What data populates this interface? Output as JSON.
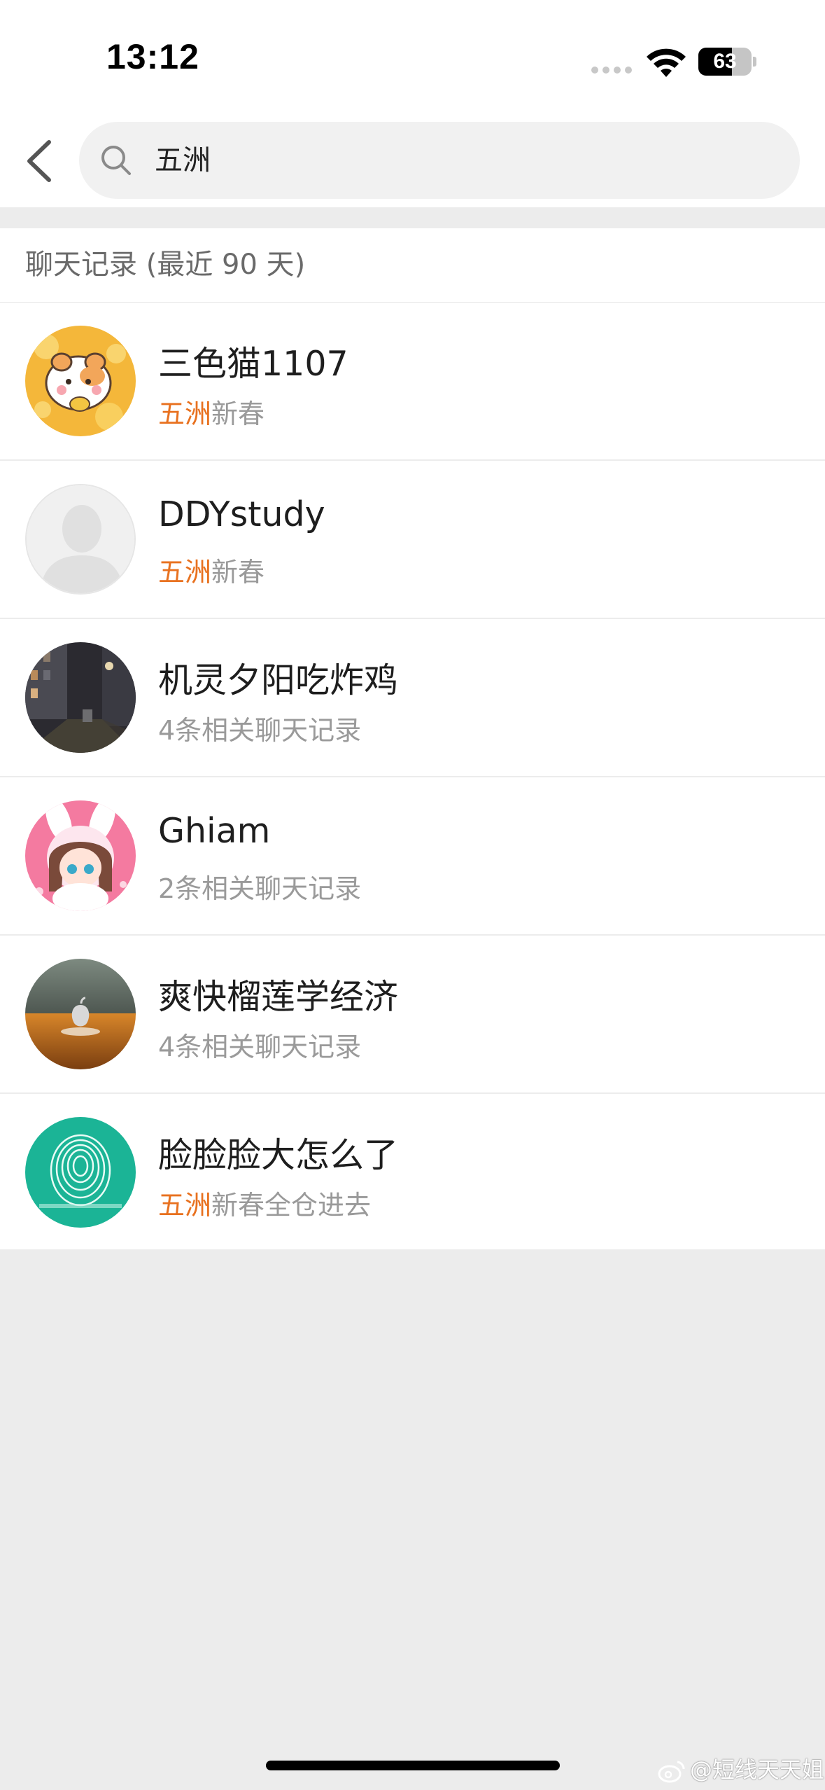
{
  "status_bar": {
    "time": "13:12",
    "battery_percent": "63",
    "battery_level": 0.63
  },
  "search": {
    "back_icon": "chevron-left-icon",
    "search_icon": "search-icon",
    "query": "五洲"
  },
  "section": {
    "title": "聊天记录 (最近 90 天)"
  },
  "results": [
    {
      "name": "三色猫1107",
      "sub_highlight": "五洲",
      "sub_text": "新春",
      "avatar": "hamster-cartoon"
    },
    {
      "name": "DDYstudy",
      "sub_highlight": "五洲",
      "sub_text": "新春",
      "avatar": "default-person"
    },
    {
      "name": "机灵夕阳吃炸鸡",
      "sub_highlight": "",
      "sub_text": "4条相关聊天记录",
      "avatar": "night-street-photo"
    },
    {
      "name": "Ghiam",
      "sub_highlight": "",
      "sub_text": "2条相关聊天记录",
      "avatar": "anime-girl-bunny"
    },
    {
      "name": "爽快榴莲学经济",
      "sub_highlight": "",
      "sub_text": "4条相关聊天记录",
      "avatar": "apple-logo-table"
    },
    {
      "name": "脸脸脸大怎么了",
      "sub_highlight": "五洲",
      "sub_text": "新春全仓进去",
      "avatar": "fingerprint-teal"
    }
  ],
  "watermark": {
    "text": "@短线天天姐",
    "icon": "weibo-icon"
  },
  "colors": {
    "highlight": "#e8711f",
    "background": "#ececec",
    "search_box": "#f1f1f1"
  }
}
